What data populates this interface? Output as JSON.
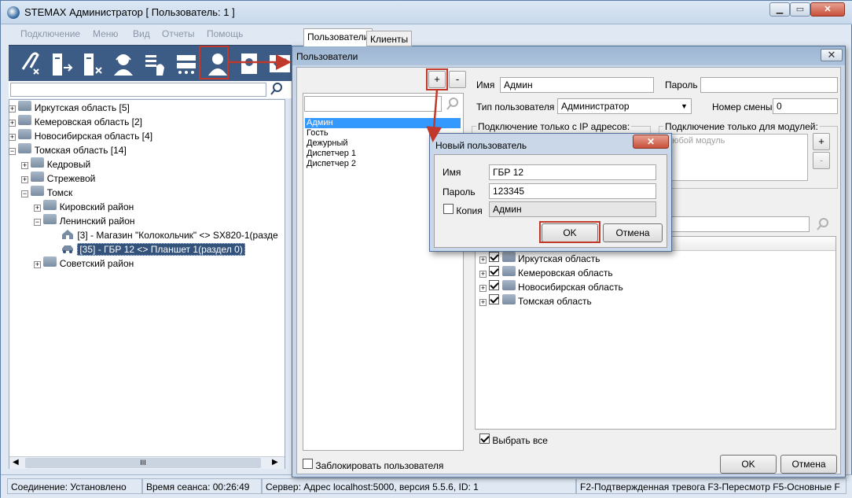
{
  "window": {
    "title": "STEMAX Администратор [ Пользователь: 1 ]",
    "min_label": "▁",
    "max_label": "▭",
    "close_label": "✕"
  },
  "menu": [
    "Подключение",
    "Меню",
    "Вид",
    "Отчеты",
    "Помощь"
  ],
  "toolbar": {
    "icons": [
      "link-icon",
      "disconnect-icon",
      "remove-object-icon",
      "operator-icon",
      "module-icon",
      "server-icon",
      "users-icon",
      "reports-icon",
      "confirm-icon"
    ]
  },
  "tree": {
    "items": [
      {
        "label": "Иркутская область [5]"
      },
      {
        "label": "Кемеровская область [2]"
      },
      {
        "label": "Новосибирская область [4]"
      },
      {
        "label": "Томская область [14]"
      },
      {
        "label": "Кедровый"
      },
      {
        "label": "Стрежевой"
      },
      {
        "label": "Томск"
      },
      {
        "label": "Кировский район"
      },
      {
        "label": "Ленинский район"
      },
      {
        "label": "[3] - Магазин \"Колокольчик\" <> SX820-1(разде"
      },
      {
        "label": "[35] - ГБР 12 <> Планшет 1(раздел 0)"
      },
      {
        "label": "Советский район"
      }
    ],
    "scroll_label": "III"
  },
  "status": {
    "connection": "Соединение: Установлено",
    "session": "Время сеанса: 00:26:49",
    "server": "Сервер: Адрес localhost:5000, версия 5.5.6, ID: 1",
    "right": "F2-Подтвержденная тревога F3-Пересмотр F5-Основные F"
  },
  "users_dialog": {
    "title": "Пользователи",
    "close_label": "✕",
    "tabs": [
      "Пользователи",
      "Клиенты"
    ],
    "add_label": "+",
    "remove_label": "-",
    "users": [
      "Админ",
      "Гость",
      "Дежурный",
      "Диспетчер 1",
      "Диспетчер 2"
    ],
    "name_label": "Имя",
    "name_value": "Админ",
    "password_label": "Пароль",
    "password_value": "",
    "type_label": "Тип пользователя",
    "type_value": "Администратор",
    "shift_label": "Номер смены",
    "shift_value": "0",
    "ip_label": "Подключение только с IP адресов:",
    "modules_label": "Подключение только для модулей:",
    "modules_placeholder": "Любой модуль",
    "mod_add": "+",
    "mod_remove": "-",
    "regions": [
      "Иркутская область",
      "Кемеровская область",
      "Новосибирская область",
      "Томская область"
    ],
    "select_all": "Выбрать все",
    "block_user": "Заблокировать пользователя",
    "ok": "OK",
    "cancel": "Отмена"
  },
  "new_user_dialog": {
    "title": "Новый пользователь",
    "close_label": "✕",
    "name_label": "Имя",
    "name_value": "ГБР 12",
    "password_label": "Пароль",
    "password_value": "123345",
    "copy_label": "Копия",
    "copy_value": "Админ",
    "ok": "OK",
    "cancel": "Отмена"
  },
  "colors": {
    "highlight": "#c0392b",
    "selection": "#3399ff",
    "tree_selection": "#34527a"
  }
}
